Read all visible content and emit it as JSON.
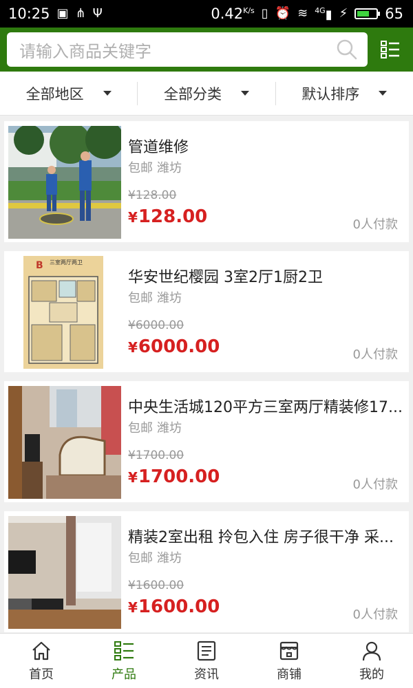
{
  "status_bar": {
    "time": "10:25",
    "speed": "0.42",
    "speed_unit": "K/s",
    "network": "4G",
    "battery": "65",
    "battery_level": 0.65
  },
  "search": {
    "placeholder": "请输入商品关键字"
  },
  "filters": [
    {
      "label": "全部地区"
    },
    {
      "label": "全部分类"
    },
    {
      "label": "默认排序"
    }
  ],
  "products": [
    {
      "title": "管道维修",
      "shipping": "包邮",
      "city": "潍坊",
      "old_price": "¥128.00",
      "price": "128.00",
      "sold": "0人付款",
      "image": "pipe-repair-photo"
    },
    {
      "title": "华安世纪樱园 3室2厅1厨2卫",
      "shipping": "包邮",
      "city": "潍坊",
      "old_price": "¥6000.00",
      "price": "6000.00",
      "sold": "0人付款",
      "image": "floor-plan",
      "image_text": "三室两厅两卫"
    },
    {
      "title": "中央生活城120平方三室两厅精装修17...",
      "shipping": "包邮",
      "city": "潍坊",
      "old_price": "¥1700.00",
      "price": "1700.00",
      "sold": "0人付款",
      "image": "living-room-photo"
    },
    {
      "title": "精装2室出租 拎包入住 房子很干净 采...",
      "shipping": "包邮",
      "city": "潍坊",
      "old_price": "¥1600.00",
      "price": "1600.00",
      "sold": "0人付款",
      "image": "apartment-photo"
    }
  ],
  "currency": "¥",
  "nav": [
    {
      "label": "首页",
      "icon": "home-icon"
    },
    {
      "label": "产品",
      "icon": "products-icon",
      "active": true
    },
    {
      "label": "资讯",
      "icon": "news-icon"
    },
    {
      "label": "商铺",
      "icon": "shop-icon"
    },
    {
      "label": "我的",
      "icon": "profile-icon"
    }
  ],
  "colors": {
    "brand_green": "#2e7a0e",
    "price_red": "#d62020"
  }
}
